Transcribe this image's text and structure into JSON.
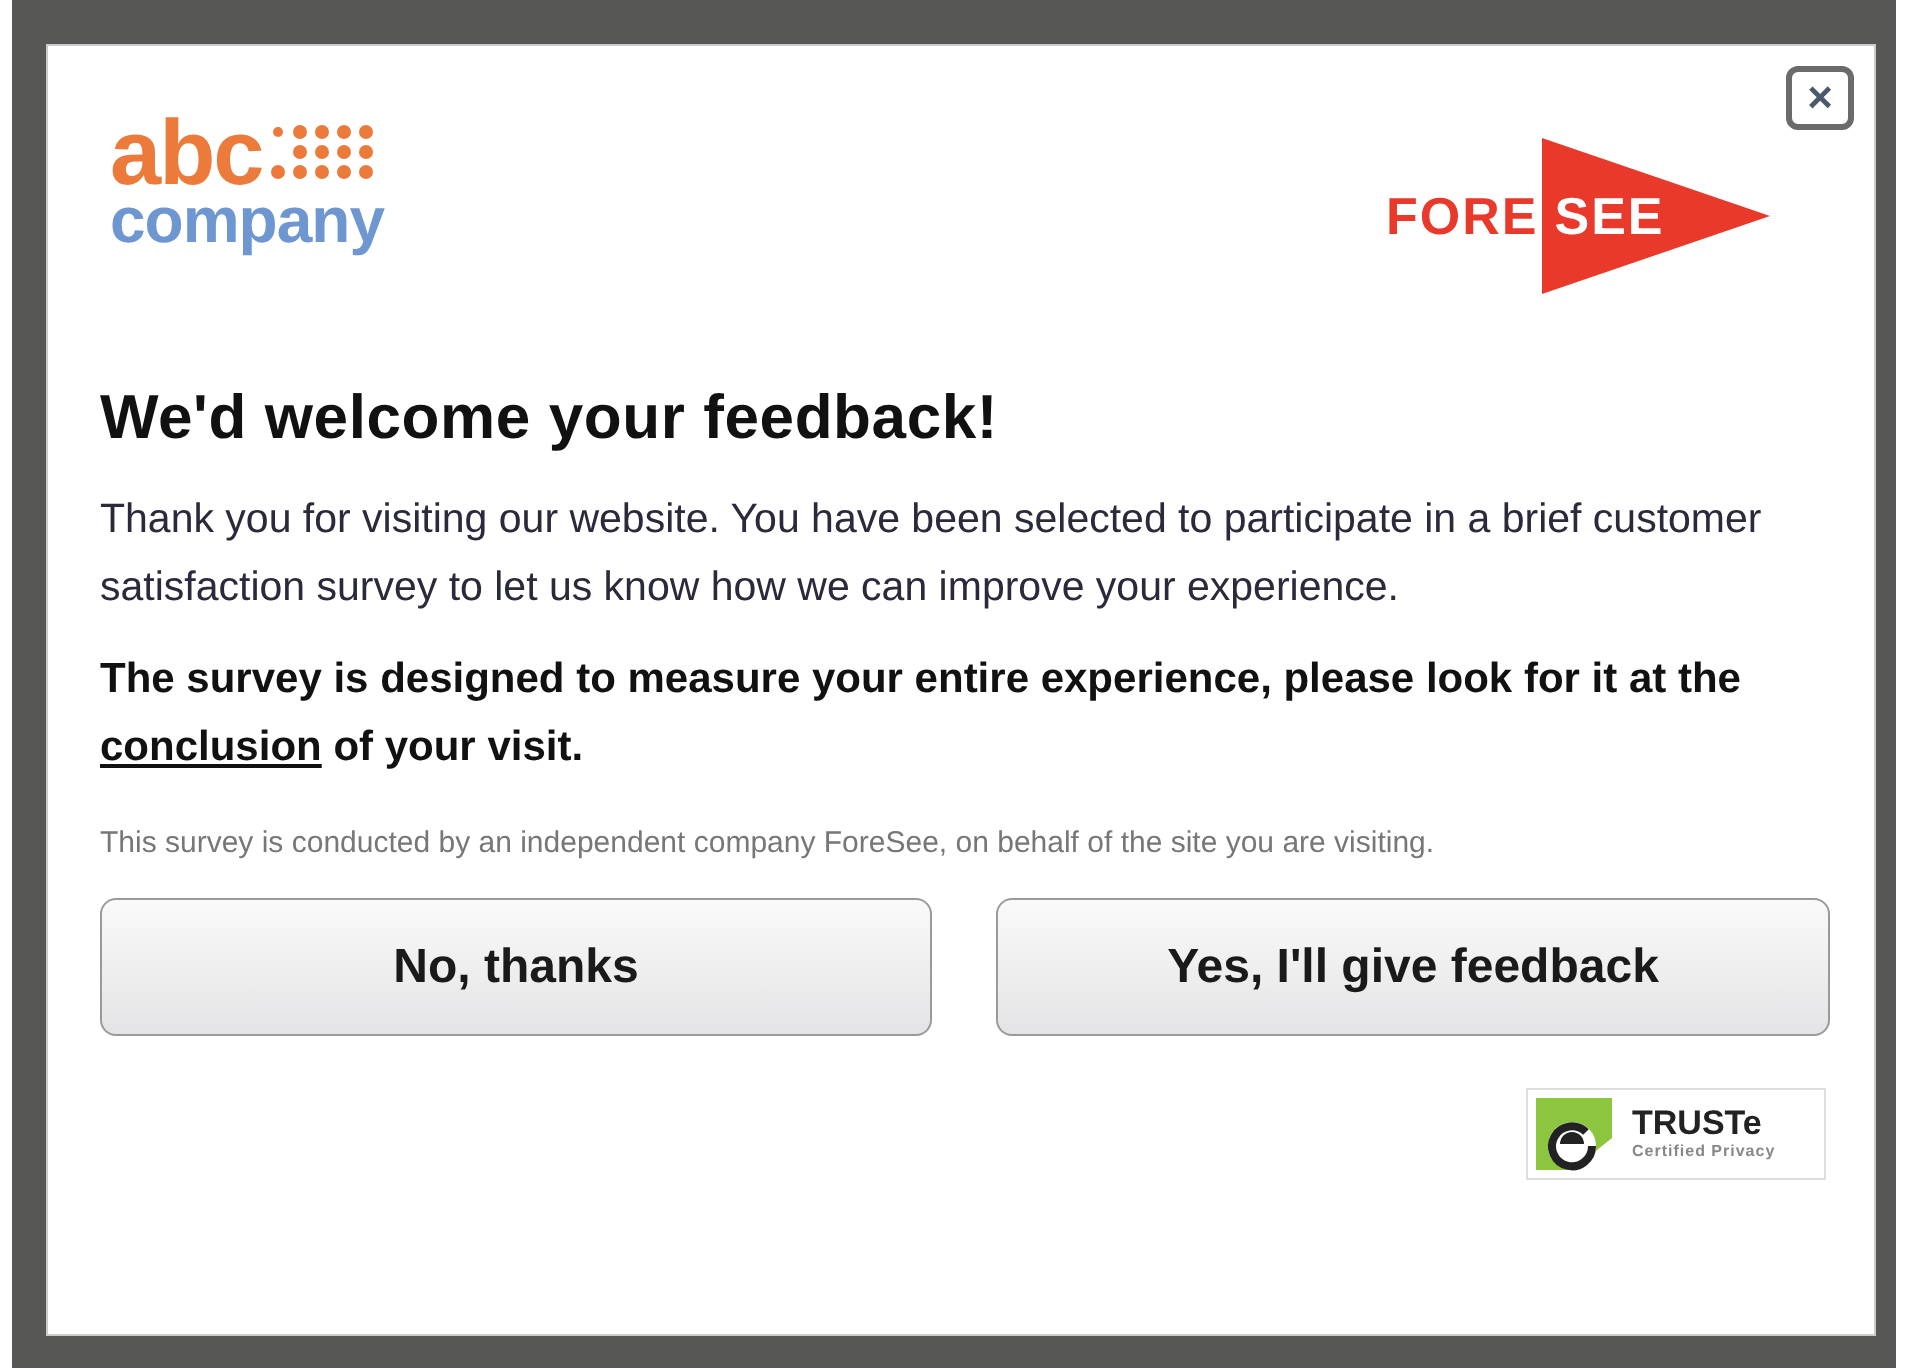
{
  "dialog": {
    "close": "×",
    "brand_logo": {
      "line_1": "abc",
      "line_2": "company"
    },
    "partner_logo": {
      "part_1": "FORE",
      "part_2": "SEE"
    },
    "title": "We'd welcome your feedback!",
    "intro": "Thank you for visiting our website. You have been selected to participate in a brief customer satisfaction survey to let us know how we can improve your experience.",
    "notice": {
      "before": "The survey is designed to measure your entire experience, please look for it at the ",
      "link": "conclusion",
      "after": " of your visit."
    },
    "disclaimer": "This survey is conducted by an independent company ForeSee, on behalf of the site you are visiting.",
    "buttons": [
      {
        "label": "No, thanks",
        "kind": "decline"
      },
      {
        "label": "Yes, I'll give feedback",
        "kind": "accept"
      }
    ],
    "seal": {
      "name": "TRUSTe",
      "caption": "Certified Privacy"
    }
  }
}
